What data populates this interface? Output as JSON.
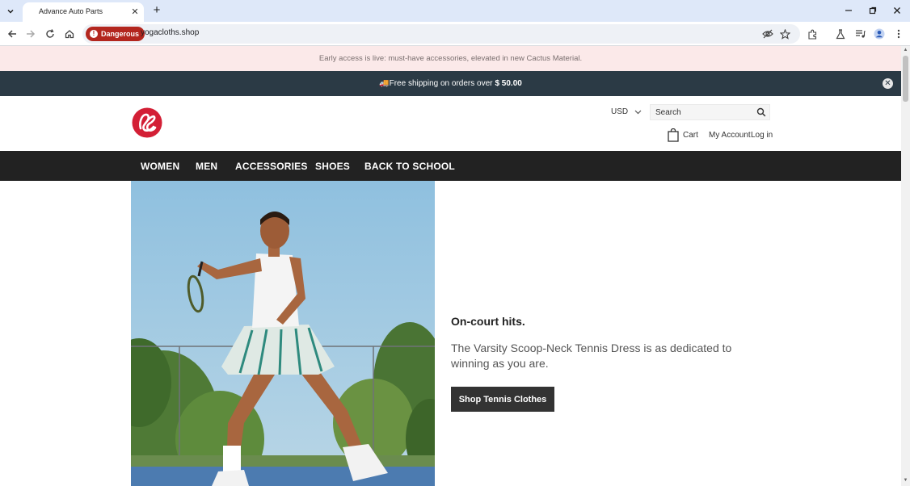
{
  "browser": {
    "tab_title": "Advance Auto Parts",
    "security_label": "Dangerous",
    "url": "yogacloths.shop"
  },
  "announcement": {
    "text": "Early access is live: must-have accessories, elevated in new Cactus Material."
  },
  "shipping": {
    "text": "🚚Free shipping on orders over",
    "amount": "$ 50.00"
  },
  "header": {
    "currency": "USD",
    "search_placeholder": "Search",
    "cart_label": "Cart",
    "account_label": "My Account",
    "login_label": "Log in"
  },
  "nav": {
    "items": [
      {
        "label": "WOMEN"
      },
      {
        "label": "MEN"
      },
      {
        "label": "ACCESSORIES"
      },
      {
        "label": "SHOES"
      },
      {
        "label": "BACK TO SCHOOL"
      }
    ]
  },
  "hero": {
    "title": "On-court hits.",
    "description": "The Varsity Scoop-Neck Tennis Dress is as dedicated to winning as you are.",
    "button_label": "Shop Tennis Clothes"
  },
  "colors": {
    "danger": "#b3261e",
    "announcement_bg": "#fbe9e9",
    "shipping_bg": "#2b3a45",
    "nav_bg": "#222222",
    "button_bg": "#333333",
    "logo_red": "#d31f35"
  }
}
